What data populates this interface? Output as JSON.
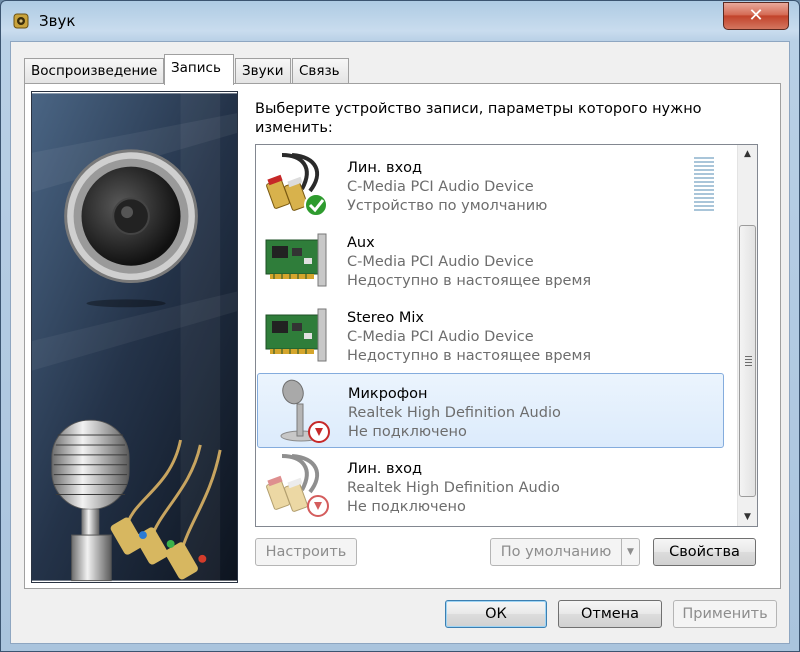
{
  "window": {
    "title": "Звук",
    "close_label": "✕"
  },
  "tabs": [
    {
      "label": "Воспроизведение",
      "active": false
    },
    {
      "label": "Запись",
      "active": true
    },
    {
      "label": "Звуки",
      "active": false
    },
    {
      "label": "Связь",
      "active": false
    }
  ],
  "prompt": "Выберите устройство записи, параметры которого нужно изменить:",
  "devices": [
    {
      "name": "Лин. вход",
      "driver": "C-Media PCI Audio Device",
      "status": "Устройство по умолчанию",
      "icon": "line-in-default-icon"
    },
    {
      "name": "Aux",
      "driver": "C-Media PCI Audio Device",
      "status": "Недоступно в настоящее время",
      "icon": "sound-card-icon"
    },
    {
      "name": "Stereo Mix",
      "driver": "C-Media PCI Audio Device",
      "status": "Недоступно в настоящее время",
      "icon": "sound-card-icon"
    },
    {
      "name": "Микрофон",
      "driver": "Realtek High Definition Audio",
      "status": "Не подключено",
      "icon": "microphone-unplugged-icon"
    },
    {
      "name": "Лин. вход",
      "driver": "Realtek High Definition Audio",
      "status": "Не подключено",
      "icon": "line-in-unplugged-icon"
    }
  ],
  "buttons": {
    "configure": "Настроить",
    "set_default": "По умолчанию",
    "properties": "Свойства",
    "ok": "ОК",
    "cancel": "Отмена",
    "apply": "Применить"
  },
  "colors": {
    "selection": "#dcebfc",
    "disabled_text": "#8d8d8d",
    "close": "#c2432b"
  }
}
